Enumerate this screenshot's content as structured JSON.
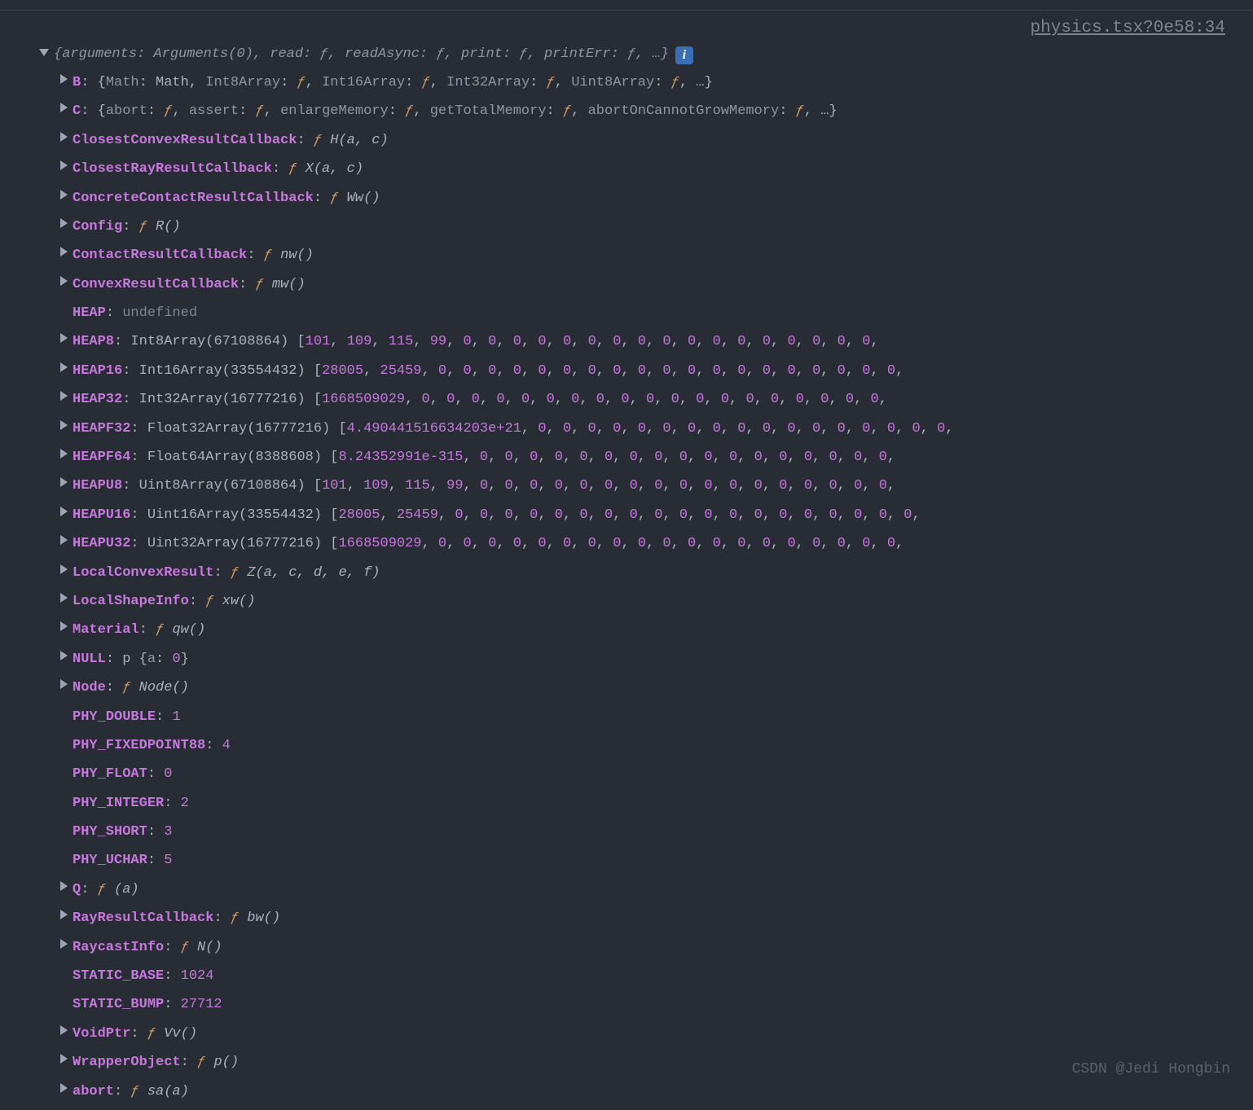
{
  "source_link": "physics.tsx?0e58:34",
  "watermark": "CSDN @Jedi Hongbin",
  "root_summary": {
    "open_brace": "{",
    "parts": [
      {
        "k": "arguments",
        "v": "Arguments(0)"
      },
      {
        "k": "read",
        "v": "ƒ"
      },
      {
        "k": "readAsync",
        "v": "ƒ"
      },
      {
        "k": "print",
        "v": "ƒ"
      },
      {
        "k": "printErr",
        "v": "ƒ"
      }
    ],
    "ellipsis": "…",
    "close_brace": "}"
  },
  "rows": [
    {
      "tri": true,
      "key": "B",
      "type": "obj",
      "obj": {
        "parts": [
          {
            "k": "Math",
            "v": "Math",
            "plain": true
          },
          {
            "k": "Int8Array",
            "v": "ƒ"
          },
          {
            "k": "Int16Array",
            "v": "ƒ"
          },
          {
            "k": "Int32Array",
            "v": "ƒ"
          },
          {
            "k": "Uint8Array",
            "v": "ƒ"
          }
        ],
        "ellipsis": "…"
      }
    },
    {
      "tri": true,
      "key": "C",
      "type": "obj",
      "obj": {
        "parts": [
          {
            "k": "abort",
            "v": "ƒ"
          },
          {
            "k": "assert",
            "v": "ƒ"
          },
          {
            "k": "enlargeMemory",
            "v": "ƒ"
          },
          {
            "k": "getTotalMemory",
            "v": "ƒ"
          },
          {
            "k": "abortOnCannotGrowMemory",
            "v": "ƒ"
          }
        ],
        "ellipsis": "…"
      }
    },
    {
      "tri": true,
      "key": "ClosestConvexResultCallback",
      "type": "fn",
      "sig": "H(a, c)"
    },
    {
      "tri": true,
      "key": "ClosestRayResultCallback",
      "type": "fn",
      "sig": "X(a, c)"
    },
    {
      "tri": true,
      "key": "ConcreteContactResultCallback",
      "type": "fn",
      "sig": "Ww()"
    },
    {
      "tri": true,
      "key": "Config",
      "type": "fn",
      "sig": "R()"
    },
    {
      "tri": true,
      "key": "ContactResultCallback",
      "type": "fn",
      "sig": "nw()"
    },
    {
      "tri": true,
      "key": "ConvexResultCallback",
      "type": "fn",
      "sig": "mw()"
    },
    {
      "tri": false,
      "key": "HEAP",
      "type": "undef",
      "val": "undefined"
    },
    {
      "tri": true,
      "key": "HEAP8",
      "type": "arr",
      "arrtype": "Int8Array(67108864)",
      "vals": [
        "101",
        "109",
        "115",
        "99",
        "0",
        "0",
        "0",
        "0",
        "0",
        "0",
        "0",
        "0",
        "0",
        "0",
        "0",
        "0",
        "0",
        "0",
        "0",
        "0",
        "0"
      ]
    },
    {
      "tri": true,
      "key": "HEAP16",
      "type": "arr",
      "arrtype": "Int16Array(33554432)",
      "vals": [
        "28005",
        "25459",
        "0",
        "0",
        "0",
        "0",
        "0",
        "0",
        "0",
        "0",
        "0",
        "0",
        "0",
        "0",
        "0",
        "0",
        "0",
        "0",
        "0",
        "0",
        "0"
      ]
    },
    {
      "tri": true,
      "key": "HEAP32",
      "type": "arr",
      "arrtype": "Int32Array(16777216)",
      "vals": [
        "1668509029",
        "0",
        "0",
        "0",
        "0",
        "0",
        "0",
        "0",
        "0",
        "0",
        "0",
        "0",
        "0",
        "0",
        "0",
        "0",
        "0",
        "0",
        "0",
        "0"
      ]
    },
    {
      "tri": true,
      "key": "HEAPF32",
      "type": "arr",
      "arrtype": "Float32Array(16777216)",
      "vals": [
        "4.490441516634203e+21",
        "0",
        "0",
        "0",
        "0",
        "0",
        "0",
        "0",
        "0",
        "0",
        "0",
        "0",
        "0",
        "0",
        "0",
        "0",
        "0",
        "0"
      ]
    },
    {
      "tri": true,
      "key": "HEAPF64",
      "type": "arr",
      "arrtype": "Float64Array(8388608)",
      "vals": [
        "8.24352991e-315",
        "0",
        "0",
        "0",
        "0",
        "0",
        "0",
        "0",
        "0",
        "0",
        "0",
        "0",
        "0",
        "0",
        "0",
        "0",
        "0",
        "0"
      ]
    },
    {
      "tri": true,
      "key": "HEAPU8",
      "type": "arr",
      "arrtype": "Uint8Array(67108864)",
      "vals": [
        "101",
        "109",
        "115",
        "99",
        "0",
        "0",
        "0",
        "0",
        "0",
        "0",
        "0",
        "0",
        "0",
        "0",
        "0",
        "0",
        "0",
        "0",
        "0",
        "0",
        "0"
      ]
    },
    {
      "tri": true,
      "key": "HEAPU16",
      "type": "arr",
      "arrtype": "Uint16Array(33554432)",
      "vals": [
        "28005",
        "25459",
        "0",
        "0",
        "0",
        "0",
        "0",
        "0",
        "0",
        "0",
        "0",
        "0",
        "0",
        "0",
        "0",
        "0",
        "0",
        "0",
        "0",
        "0",
        "0"
      ]
    },
    {
      "tri": true,
      "key": "HEAPU32",
      "type": "arr",
      "arrtype": "Uint32Array(16777216)",
      "vals": [
        "1668509029",
        "0",
        "0",
        "0",
        "0",
        "0",
        "0",
        "0",
        "0",
        "0",
        "0",
        "0",
        "0",
        "0",
        "0",
        "0",
        "0",
        "0",
        "0",
        "0"
      ]
    },
    {
      "tri": true,
      "key": "LocalConvexResult",
      "type": "fn",
      "sig": "Z(a, c, d, e, f)"
    },
    {
      "tri": true,
      "key": "LocalShapeInfo",
      "type": "fn",
      "sig": "xw()"
    },
    {
      "tri": true,
      "key": "Material",
      "type": "fn",
      "sig": "qw()"
    },
    {
      "tri": true,
      "key": "NULL",
      "type": "proto",
      "proto": "p",
      "inner": [
        {
          "k": "a",
          "v": "0"
        }
      ]
    },
    {
      "tri": true,
      "key": "Node",
      "type": "fn",
      "sig": "Node()"
    },
    {
      "tri": false,
      "key": "PHY_DOUBLE",
      "type": "num",
      "val": "1"
    },
    {
      "tri": false,
      "key": "PHY_FIXEDPOINT88",
      "type": "num",
      "val": "4"
    },
    {
      "tri": false,
      "key": "PHY_FLOAT",
      "type": "num",
      "val": "0"
    },
    {
      "tri": false,
      "key": "PHY_INTEGER",
      "type": "num",
      "val": "2"
    },
    {
      "tri": false,
      "key": "PHY_SHORT",
      "type": "num",
      "val": "3"
    },
    {
      "tri": false,
      "key": "PHY_UCHAR",
      "type": "num",
      "val": "5"
    },
    {
      "tri": true,
      "key": "Q",
      "type": "fn",
      "sig": "(a)"
    },
    {
      "tri": true,
      "key": "RayResultCallback",
      "type": "fn",
      "sig": "bw()"
    },
    {
      "tri": true,
      "key": "RaycastInfo",
      "type": "fn",
      "sig": "N()"
    },
    {
      "tri": false,
      "key": "STATIC_BASE",
      "type": "num",
      "val": "1024"
    },
    {
      "tri": false,
      "key": "STATIC_BUMP",
      "type": "num",
      "val": "27712"
    },
    {
      "tri": true,
      "key": "VoidPtr",
      "type": "fn",
      "sig": "Vv()"
    },
    {
      "tri": true,
      "key": "WrapperObject",
      "type": "fn",
      "sig": "p()"
    },
    {
      "tri": true,
      "key": "abort",
      "type": "fn",
      "sig": "sa(a)"
    }
  ]
}
